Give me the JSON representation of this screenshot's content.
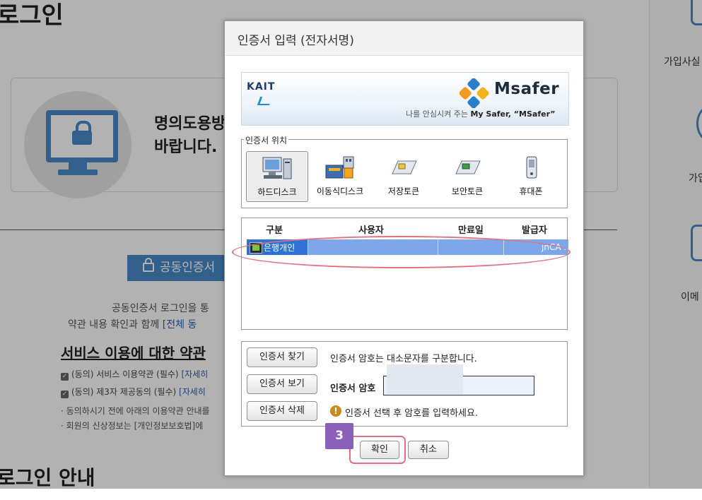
{
  "background": {
    "page_title": "로그인",
    "cert_message_line1": "명의도용방",
    "cert_message_line2": "바랍니다.",
    "cert_login_button": "공동인증서",
    "desc_line1": "공동인증서 로그인을 통",
    "desc_line2": "약관 내용 확인과 함께 ",
    "desc_link": "[전체 동",
    "terms_title": "서비스 이용에 대한 약관",
    "check_items": [
      {
        "text": "(동의) 서비스 이용약관 (필수) ",
        "link": "[자세히"
      },
      {
        "text": "(동의) 제3자 제공동의 (필수) ",
        "link": "[자세히"
      }
    ],
    "notes": [
      "· 동의하시기 전에 아래의 이용약관 안내를",
      "· 회원의 신상정보는 [개인정보보호법]에"
    ],
    "guide_title": "로그인 안내",
    "right_panel": [
      "가입사실",
      "가입",
      "이메"
    ]
  },
  "dialog": {
    "title": "인증서 입력 (전자서명)",
    "banner": {
      "left_logo": "KAIT",
      "right_logo": "Msafer",
      "slogan_prefix": "나를 안심시켜 주는 ",
      "slogan_bold": "My Safer, “MSafer”"
    },
    "location": {
      "legend": "인증서 위치",
      "items": [
        {
          "label": "하드디스크",
          "icon": "hard-disk-icon",
          "selected": true
        },
        {
          "label": "이동식디스크",
          "icon": "removable-disk-icon",
          "selected": false
        },
        {
          "label": "저장토큰",
          "icon": "storage-token-icon",
          "selected": false
        },
        {
          "label": "보안토큰",
          "icon": "security-token-icon",
          "selected": false
        },
        {
          "label": "휴대폰",
          "icon": "phone-icon",
          "selected": false
        }
      ]
    },
    "table": {
      "columns": [
        "구분",
        "사용자",
        "만료일",
        "발급자"
      ],
      "rows": [
        {
          "type": "은행개인",
          "user": "",
          "expiry": "",
          "issuer": "jnCA ..."
        }
      ]
    },
    "actions": {
      "find_button": "인증서 찾기",
      "view_button": "인증서 보기",
      "delete_button": "인증서 삭제",
      "case_hint": "인증서 암호는 대소문자를 구분합니다.",
      "password_label": "인증서 암호",
      "warning_text": "인증서 선택 후 암호를 입력하세요."
    },
    "confirm_button": "확인",
    "cancel_button": "취소",
    "step_badge": "3"
  },
  "colors": {
    "accent": "#4a88c7",
    "annotation": "#e0727f",
    "badge": "#8a60b8",
    "selected_row": "#7da7ea"
  }
}
